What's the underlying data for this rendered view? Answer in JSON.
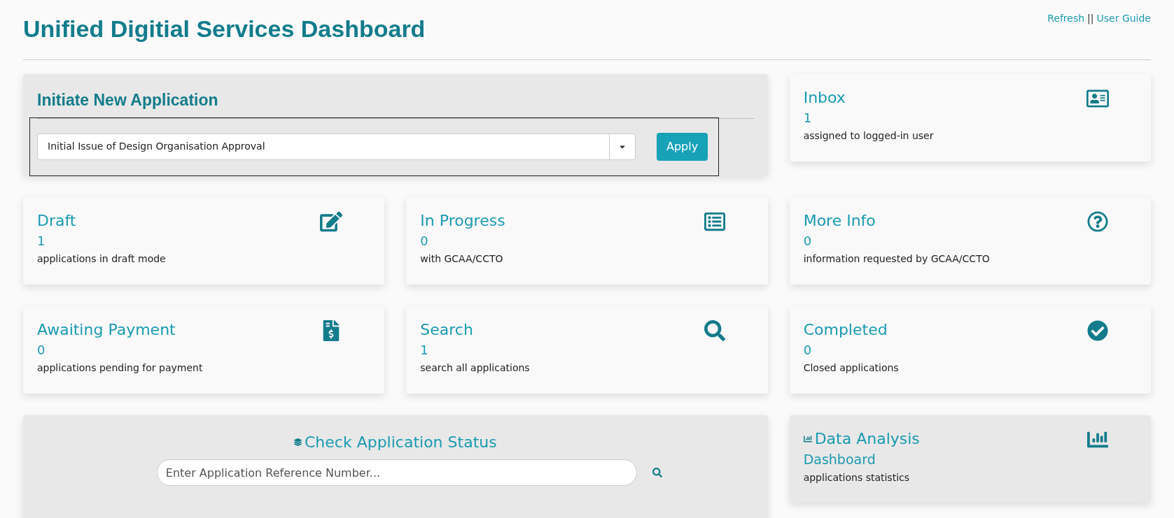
{
  "header": {
    "title": "Unified Digitial Services Dashboard",
    "links": [
      "Refresh",
      "User Guide"
    ],
    "separator": "||"
  },
  "initiate": {
    "title": "Initiate New Application",
    "select_value": "Initial Issue of Design Organisation Approval",
    "button": "Apply"
  },
  "inbox": {
    "title": "Inbox",
    "count": "1",
    "description": "assigned to logged-in user"
  },
  "cards": [
    {
      "title": "Draft",
      "count": "1",
      "description": "applications in draft mode"
    },
    {
      "title": "In Progress",
      "count": "0",
      "description": "with GCAA/CCTO"
    },
    {
      "title": "More Info",
      "count": "0",
      "description": "information requested by GCAA/CCTO"
    },
    {
      "title": "Awaiting Payment",
      "count": "0",
      "description": "applications pending for payment"
    },
    {
      "title": "Search",
      "count": "1",
      "description": "search all applications"
    },
    {
      "title": "Completed",
      "count": "0",
      "description": "Closed applications"
    }
  ],
  "status_check": {
    "title": "Check Application Status",
    "placeholder": "Enter Application Reference Number..."
  },
  "analysis": {
    "title": "Data Analysis",
    "link": "Dashboard",
    "description": "applications statistics"
  }
}
